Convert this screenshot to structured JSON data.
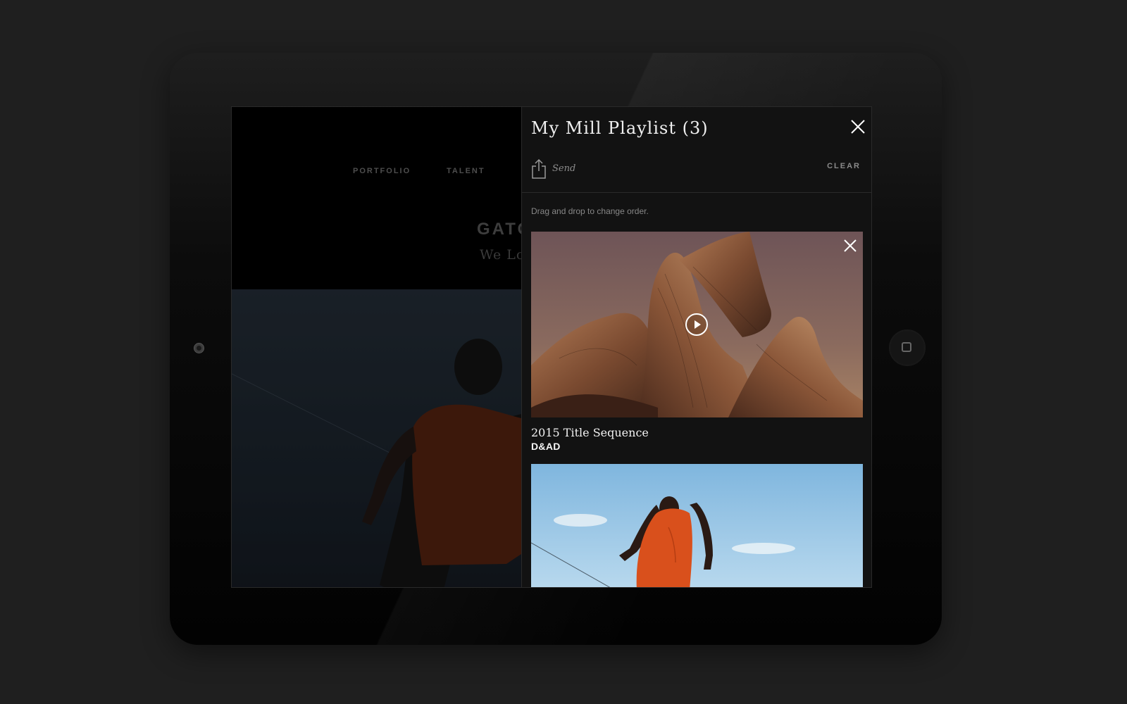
{
  "site": {
    "nav": [
      "PORTFOLIO",
      "TALENT"
    ],
    "hero_title": "GATO",
    "hero_subtitle": "We Lo"
  },
  "playlist": {
    "title": "My Mill Playlist (3)",
    "close_icon": "close-icon",
    "send_label": "Send",
    "clear_label": "CLEAR",
    "hint": "Drag and drop to change order.",
    "items": [
      {
        "title": "2015 Title Sequence",
        "client": "D&AD",
        "icon": "play-icon"
      },
      {
        "title": "",
        "client": ""
      }
    ]
  },
  "colors": {
    "panel_bg": "#121212",
    "page_bg": "#1f1f1f",
    "shirt": "#d9501c",
    "sky": "#a8cfe8"
  }
}
